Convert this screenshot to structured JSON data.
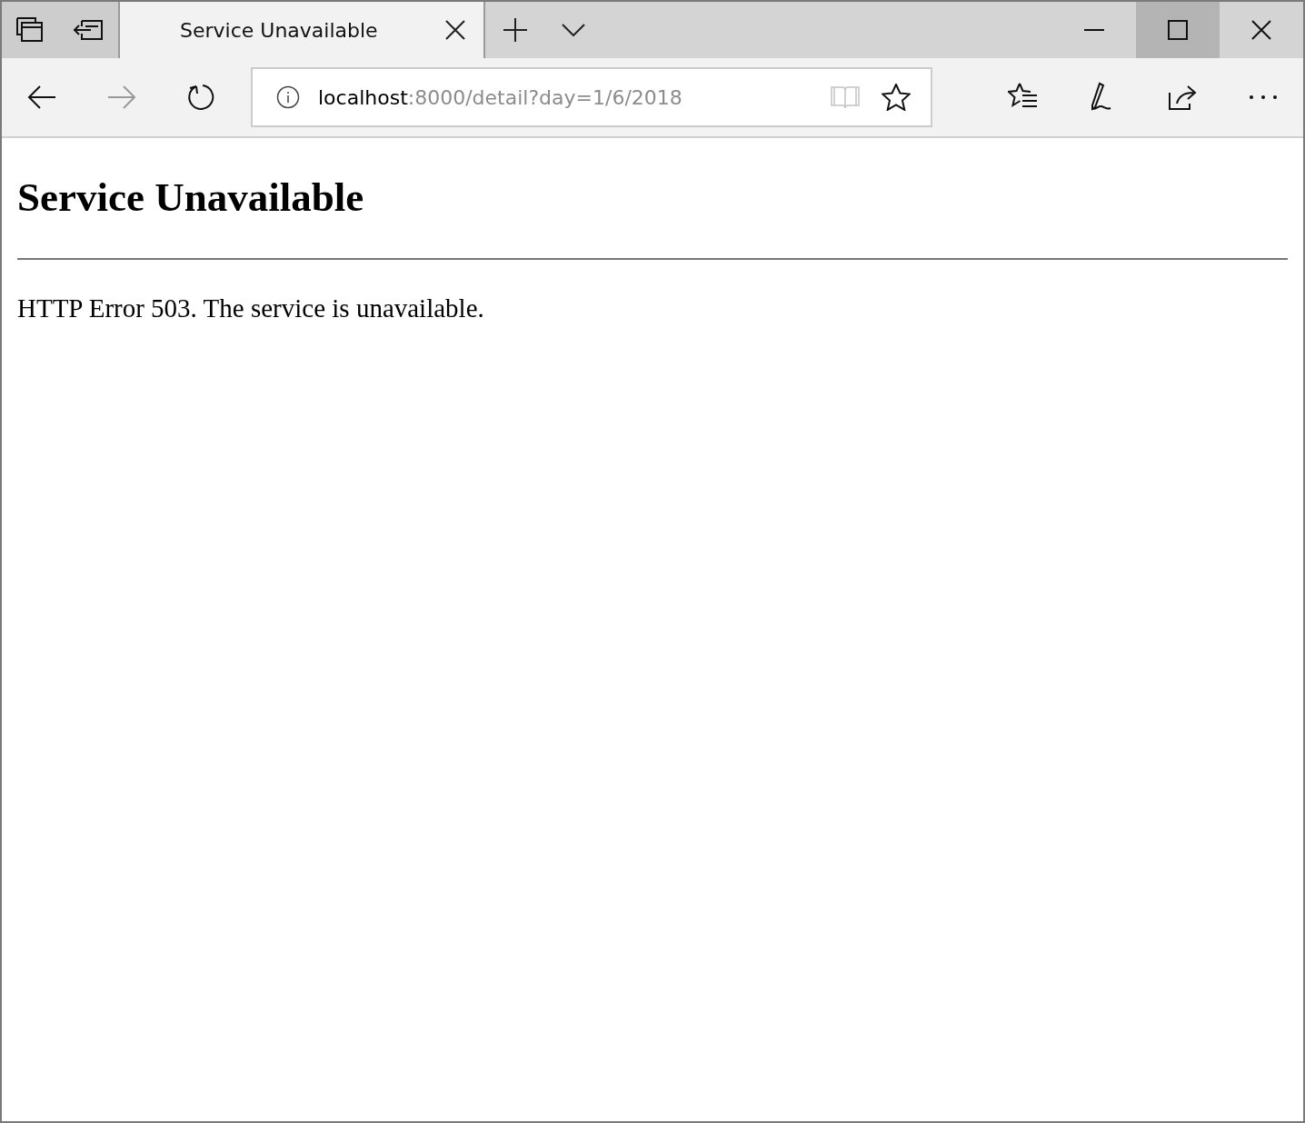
{
  "tabs": [
    {
      "title": "Service Unavailable",
      "selected": true
    }
  ],
  "toolbar": {
    "back_disabled": false,
    "forward_disabled": true,
    "reading_view_disabled": true
  },
  "window_controls": {
    "maximize_hovered": true
  },
  "address": {
    "host": "localhost",
    "rest": ":8000/detail?day=1/6/2018"
  },
  "page": {
    "heading": "Service Unavailable",
    "message": "HTTP Error 503. The service is unavailable."
  }
}
